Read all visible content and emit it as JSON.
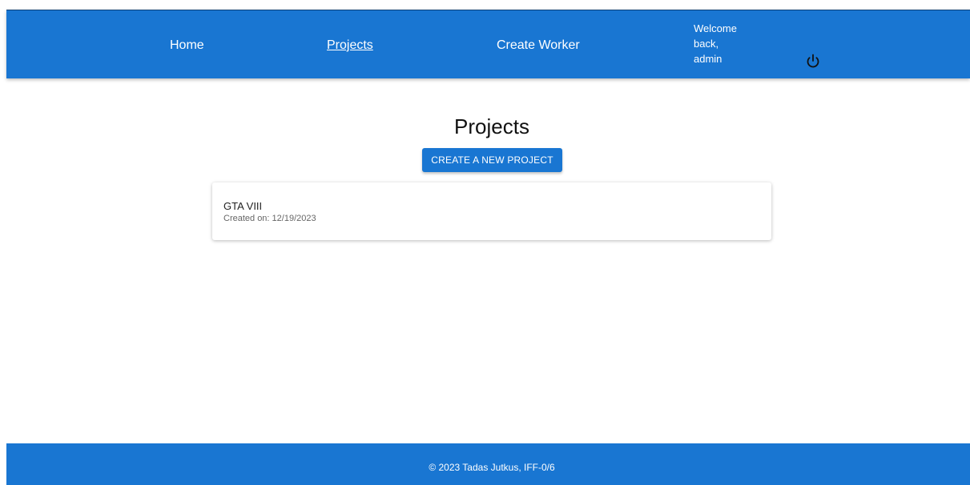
{
  "header": {
    "nav": {
      "home": "Home",
      "projects": "Projects",
      "create_worker": "Create Worker"
    },
    "welcome": {
      "line1": "Welcome",
      "line2": "back,",
      "line3": "admin"
    },
    "logout_icon": "power-icon"
  },
  "main": {
    "title": "Projects",
    "create_button": "CREATE A NEW PROJECT",
    "projects": [
      {
        "name": "GTA VIII",
        "created": "Created on: 12/19/2023"
      }
    ]
  },
  "footer": {
    "text": "© 2023 Tadas Jutkus, IFF-0/6"
  },
  "colors": {
    "primary": "#1976d2",
    "background": "#ffffff"
  }
}
